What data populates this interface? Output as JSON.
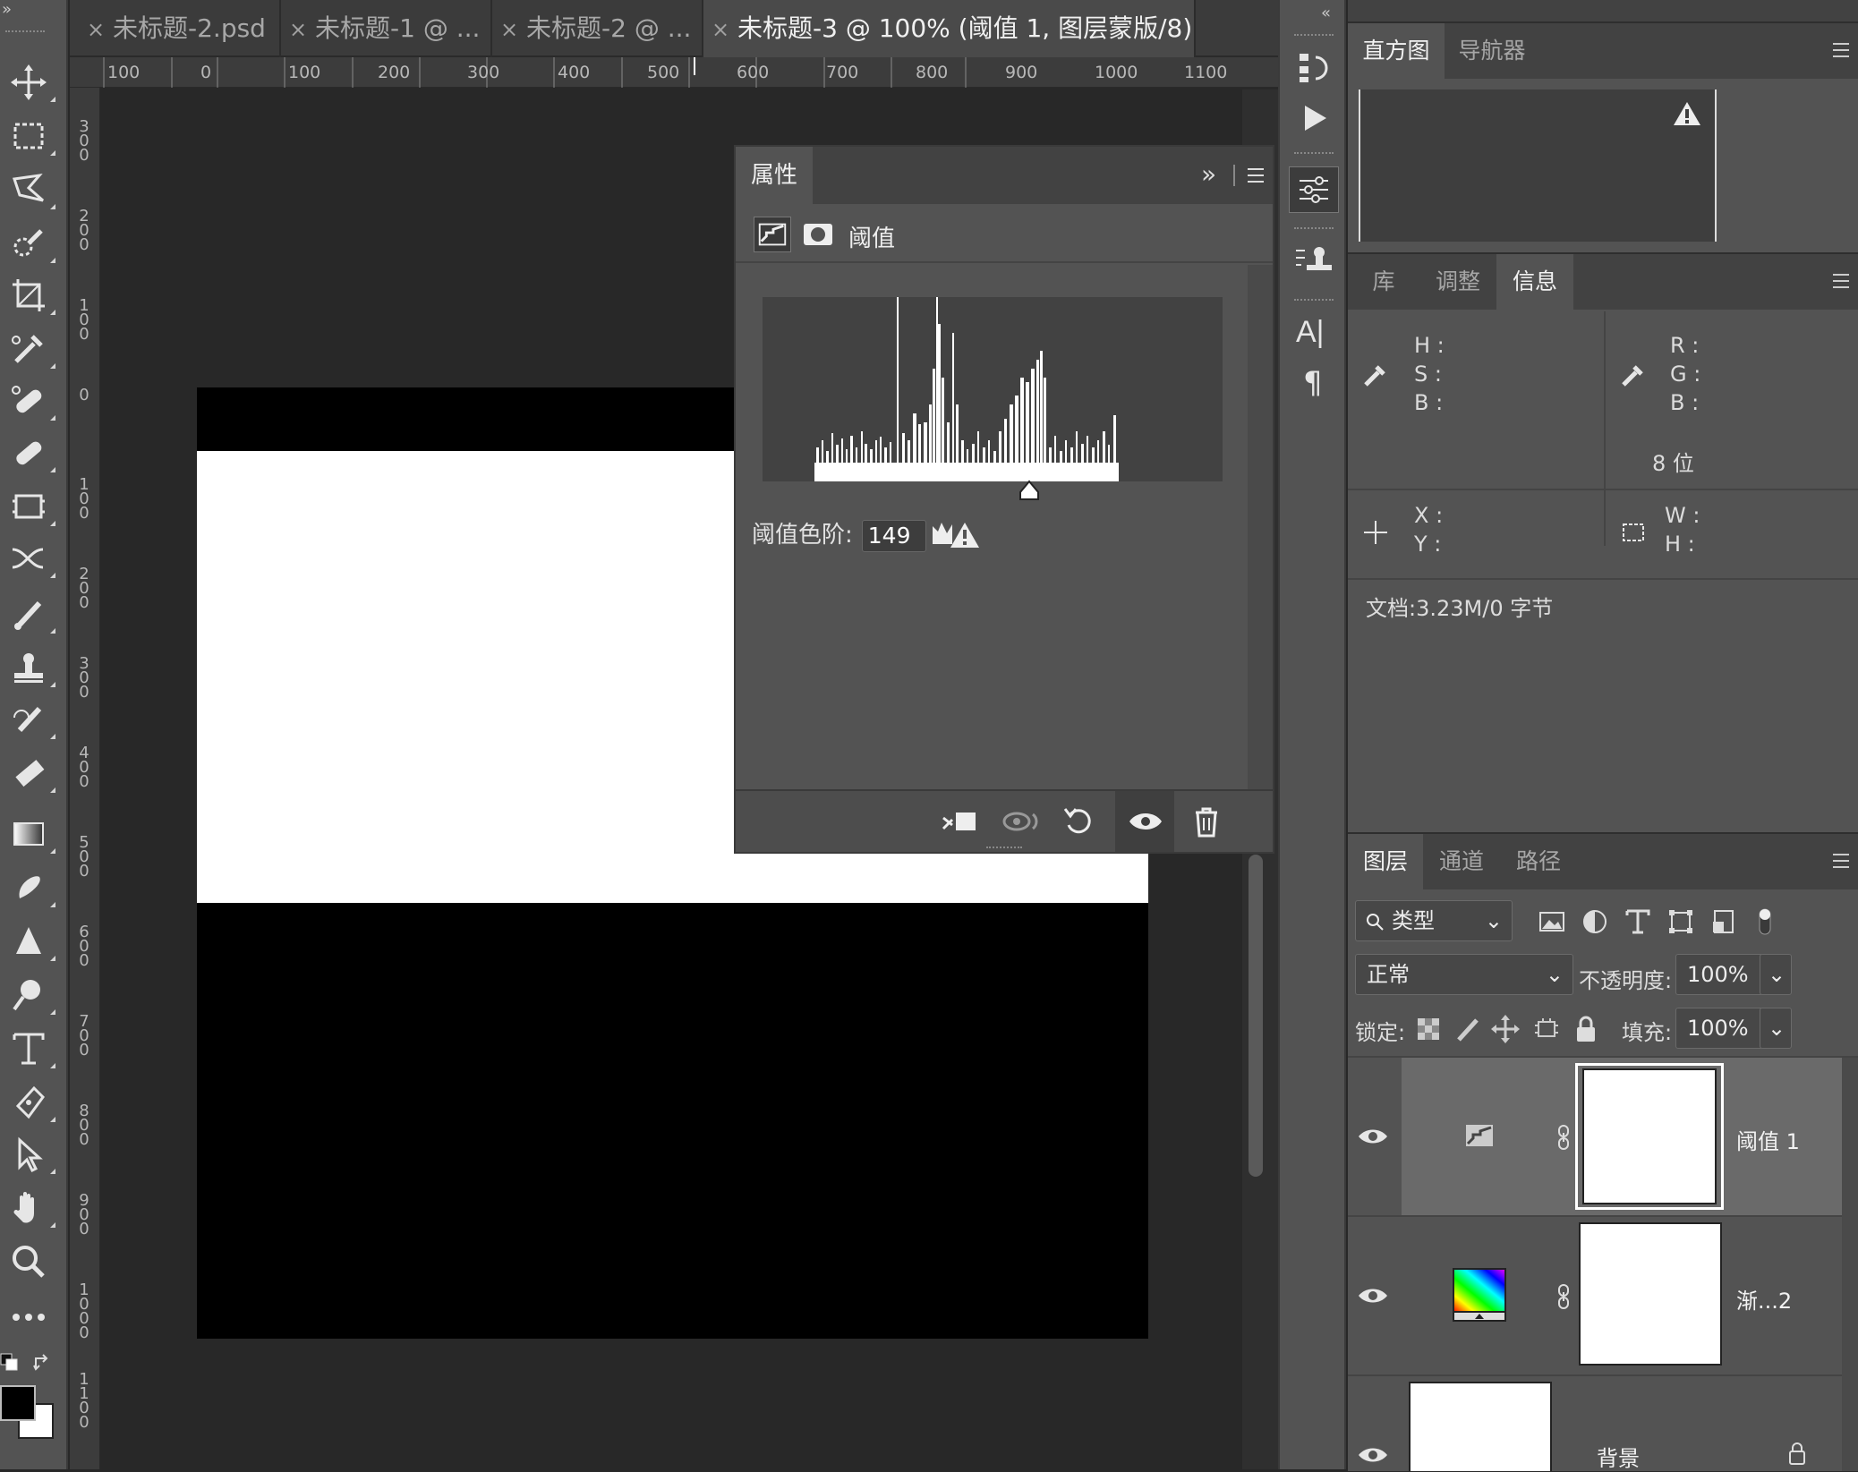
{
  "colors": {
    "ui_dark": "#282828",
    "panel": "#535353",
    "panel_header": "#424242",
    "selected_layer": "#6a6a6a"
  },
  "toolbar": {
    "collapse_label": "»",
    "tools": [
      "move-tool",
      "rect-marquee-tool",
      "lasso-tool",
      "quick-select-tool",
      "crop-tool",
      "eyedropper-tool",
      "healing-tool",
      "brush-tool",
      "stamp-tool",
      "history-brush-tool",
      "eraser-tool",
      "gradient-tool",
      "blur-tool",
      "dodge-tool",
      "pen-tool",
      "type-tool",
      "path-select-tool",
      "hand-tool",
      "zoom-tool",
      "more-tools"
    ]
  },
  "tabs": [
    {
      "label": "未标题-2.psd",
      "close": "×"
    },
    {
      "label": "未标题-1 @ ...",
      "close": "×"
    },
    {
      "label": "未标题-2 @ ...",
      "close": "×"
    },
    {
      "label": "未标题-3 @ 100% (阈值 1, 图层蒙版/8) *",
      "close": "×",
      "active": true
    }
  ],
  "ruler": {
    "top": [
      "100",
      "0",
      "100",
      "200",
      "300",
      "400",
      "500",
      "600",
      "700",
      "800",
      "900",
      "1000",
      "1100"
    ],
    "left": [
      "300",
      "200",
      "100",
      "0",
      "100",
      "200",
      "300",
      "400",
      "500",
      "600",
      "700",
      "800",
      "900",
      "1000",
      "1100"
    ]
  },
  "properties": {
    "tab": "属性",
    "expand": "»",
    "adjustment_name": "阈值",
    "threshold_label": "阈值色阶:",
    "threshold_value": "149"
  },
  "iconcol": {
    "collapse": "«",
    "type_icon": "A|",
    "para_icon": "¶"
  },
  "histogram_panel": {
    "tabs": [
      "直方图",
      "导航器"
    ]
  },
  "info_panel": {
    "tabs": [
      "库",
      "调整",
      "信息"
    ],
    "hsb": [
      "H :",
      "S :",
      "B :"
    ],
    "rgb": [
      "R :",
      "G :",
      "B :"
    ],
    "bit_depth": "8 位",
    "xy": [
      "X :",
      "Y :"
    ],
    "wh": [
      "W :",
      "H :"
    ],
    "doc": "文档:3.23M/0 字节"
  },
  "layers_panel": {
    "tabs": [
      "图层",
      "通道",
      "路径"
    ],
    "filter_kind": "类型",
    "blend_mode": "正常",
    "opacity_label": "不透明度:",
    "opacity_value": "100%",
    "lock_label": "锁定:",
    "fill_label": "填充:",
    "fill_value": "100%",
    "layers": [
      {
        "name": "阈值 1",
        "selected": true
      },
      {
        "name": "渐...2"
      },
      {
        "name": "背景"
      }
    ]
  }
}
